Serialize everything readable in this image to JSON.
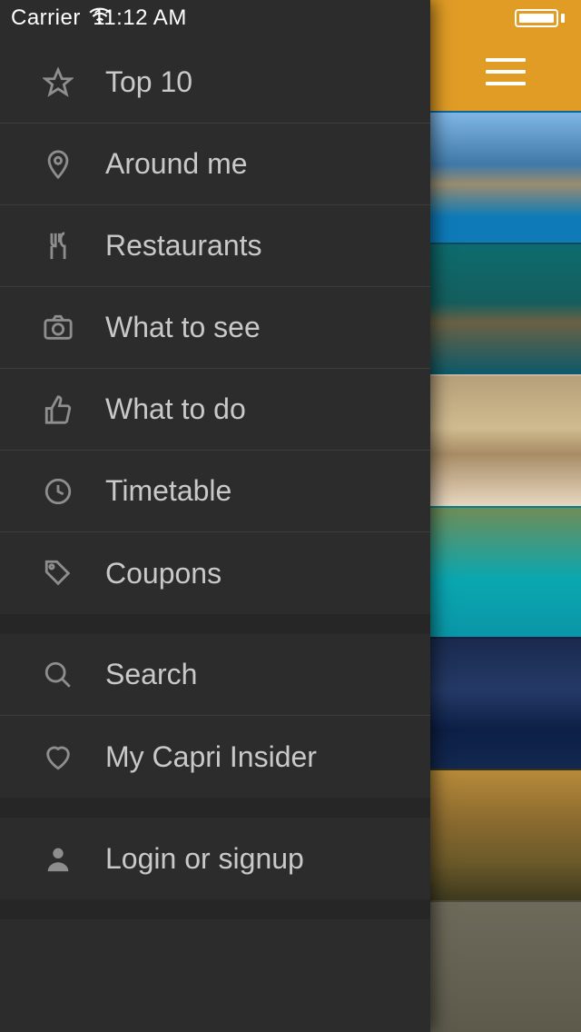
{
  "status": {
    "carrier": "Carrier",
    "time": "11:12 AM"
  },
  "menu": {
    "group1": [
      {
        "icon": "star-icon",
        "label": "Top 10"
      },
      {
        "icon": "pin-icon",
        "label": "Around me"
      },
      {
        "icon": "fork-icon",
        "label": "Restaurants"
      },
      {
        "icon": "camera-icon",
        "label": "What to see"
      },
      {
        "icon": "thumbsup-icon",
        "label": "What to do"
      },
      {
        "icon": "clock-icon",
        "label": "Timetable"
      },
      {
        "icon": "tag-icon",
        "label": "Coupons"
      }
    ],
    "group2": [
      {
        "icon": "search-icon",
        "label": "Search"
      },
      {
        "icon": "heart-icon",
        "label": "My Capri Insider"
      }
    ],
    "group3": [
      {
        "icon": "user-icon",
        "label": "Login or signup"
      }
    ]
  }
}
